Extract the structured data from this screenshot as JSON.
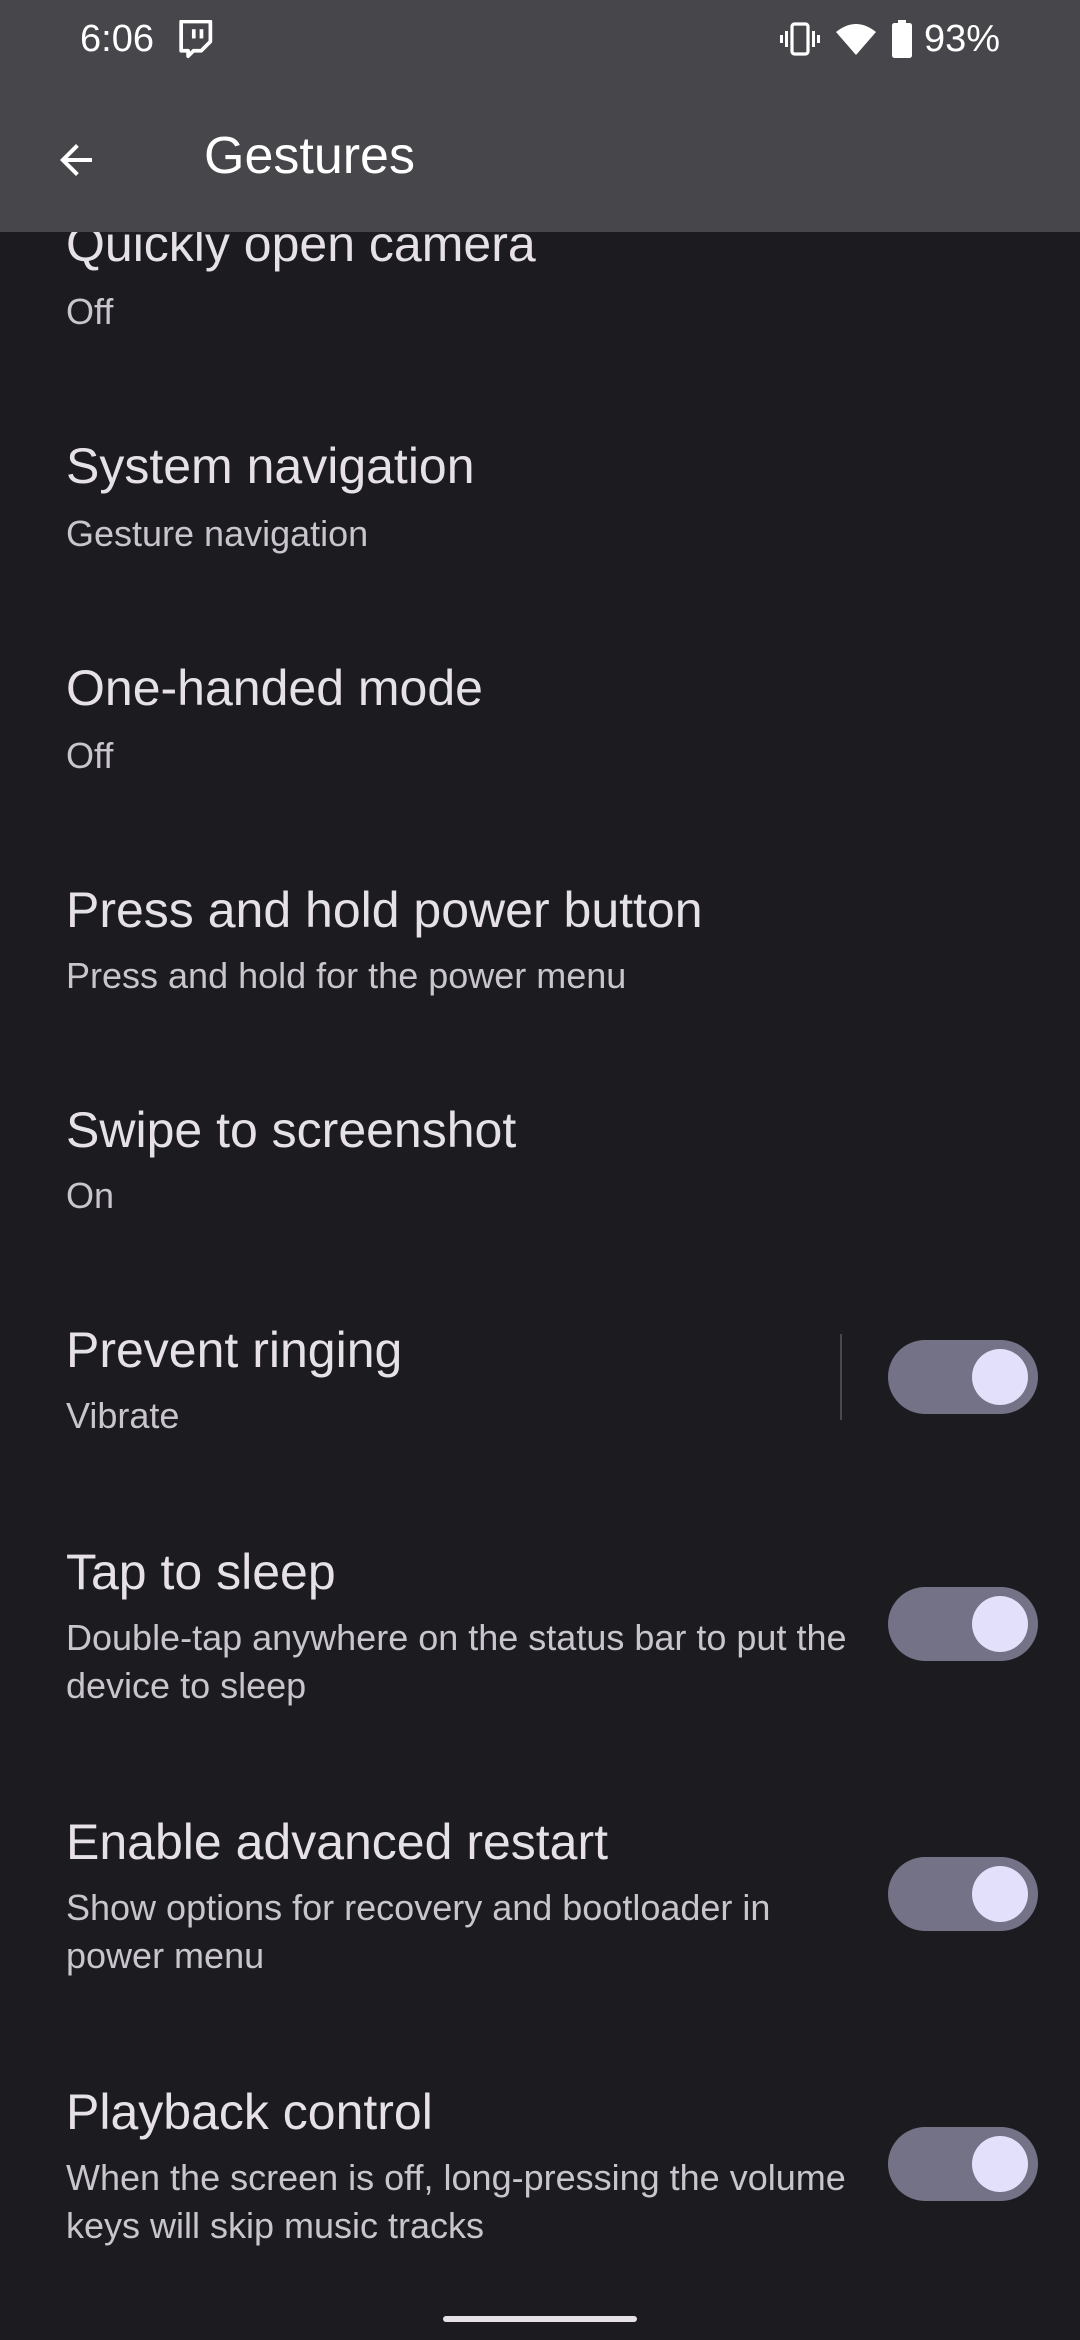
{
  "status_bar": {
    "time": "6:06",
    "battery_percent": "93%",
    "notification_icon": "twitch-icon",
    "icons": [
      "vibrate-icon",
      "wifi-icon",
      "battery-icon"
    ]
  },
  "app_bar": {
    "back_icon": "arrow-back-icon",
    "title": "Gestures"
  },
  "items": [
    {
      "title": "Quickly open camera",
      "summary": "Off"
    },
    {
      "title": "System navigation",
      "summary": "Gesture navigation"
    },
    {
      "title": "One-handed mode",
      "summary": "Off"
    },
    {
      "title": "Press and hold power button",
      "summary": "Press and hold for the power menu"
    },
    {
      "title": "Swipe to screenshot",
      "summary": "On"
    },
    {
      "title": "Prevent ringing",
      "summary": "Vibrate",
      "toggle": true
    },
    {
      "title": "Tap to sleep",
      "summary": "Double-tap anywhere on the status bar to put the device to sleep",
      "toggle": true
    },
    {
      "title": "Enable advanced restart",
      "summary": "Show options for recovery and bootloader in power menu",
      "toggle": true
    },
    {
      "title": "Playback control",
      "summary": "When the screen is off, long-pressing the volume keys will skip music tracks",
      "toggle": true
    }
  ],
  "colors": {
    "background": "#1c1b20",
    "app_bar": "#47464b",
    "toggle_track": "#737287",
    "toggle_thumb": "#e2e0fb"
  }
}
